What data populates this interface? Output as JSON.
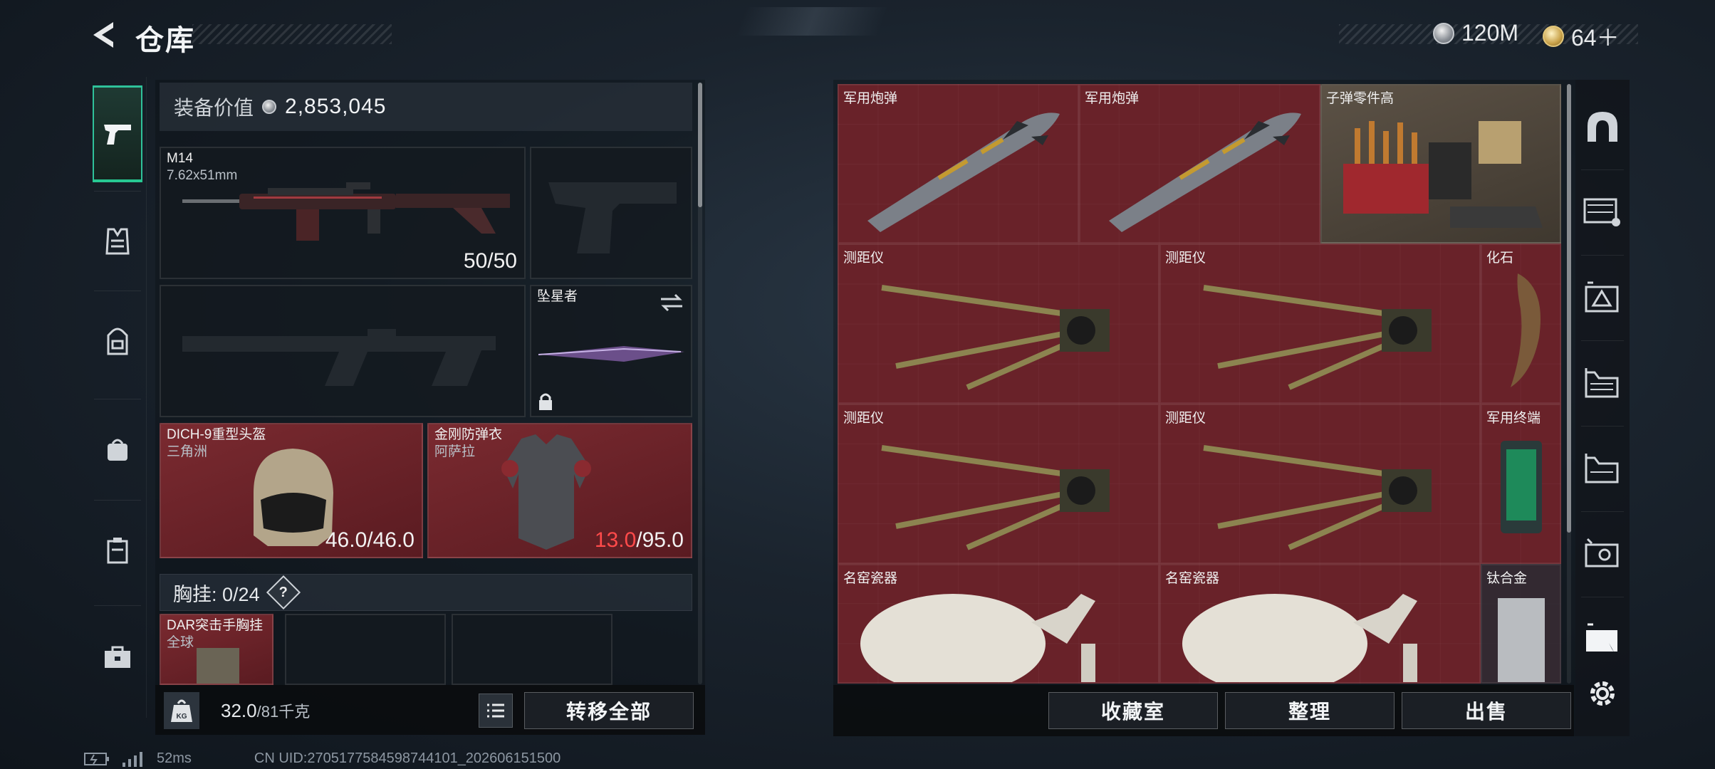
{
  "header": {
    "title": "仓库"
  },
  "currency": {
    "silver": "120M",
    "gold": "64＋"
  },
  "equipment": {
    "value_label": "装备价值",
    "value": "2,853,045",
    "primary_weapon": {
      "name": "M14",
      "caliber": "7.62x51mm",
      "ammo": "50/50"
    },
    "melee": {
      "name": "坠星者"
    },
    "helmet": {
      "name": "DICH-9重型头盔",
      "origin": "三角洲",
      "durability_current": "46.0",
      "durability_rest": "/46.0"
    },
    "armor": {
      "name": "金刚防弹衣",
      "origin": "阿萨拉",
      "durability_current": "13.0",
      "durability_rest": "/95.0"
    },
    "chest_rig": {
      "label": "胸挂:",
      "count": "0/24",
      "help": "?"
    },
    "rig_item": {
      "name": "DAR突击手胸挂",
      "origin": "全球"
    }
  },
  "bottom_left": {
    "weight_current": "32.0",
    "weight_max": "/81千克",
    "weight_icon_text": "KG",
    "transfer_all": "转移全部"
  },
  "stash": {
    "items": [
      {
        "name": "军用炮弹"
      },
      {
        "name": "军用炮弹"
      },
      {
        "name": "子弹零件高"
      },
      {
        "name": "测距仪"
      },
      {
        "name": "测距仪"
      },
      {
        "name": "化石"
      },
      {
        "name": "测距仪"
      },
      {
        "name": "测距仪"
      },
      {
        "name": "军用终端"
      },
      {
        "name": "名窑瓷器"
      },
      {
        "name": "名窑瓷器"
      },
      {
        "name": "钛合金"
      }
    ]
  },
  "bottom_right": {
    "collection": "收藏室",
    "organize": "整理",
    "sell": "出售"
  },
  "status": {
    "ping": "52ms",
    "uid": "CN UID:2705177584598744101_202606151500"
  },
  "colors": {
    "accent": "#27c892",
    "low_durability": "#ff4a4a",
    "cell_red": "#5e1e24",
    "cell_gold": "#4e463c"
  }
}
